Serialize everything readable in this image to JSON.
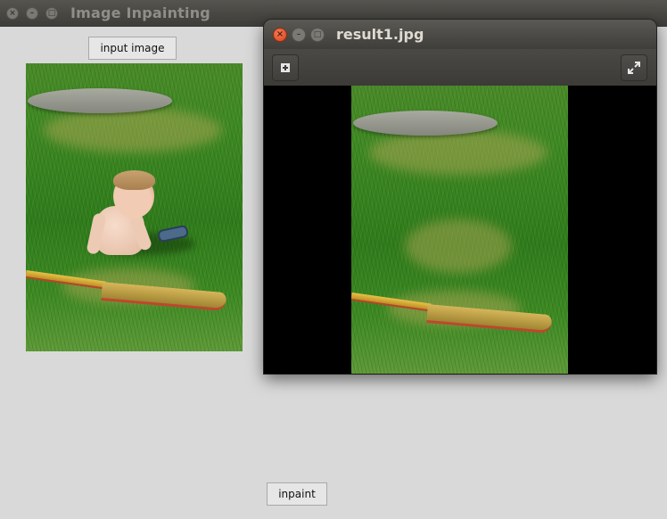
{
  "main_window": {
    "title": "Image Inpainting",
    "input_button_label": "input image",
    "inpaint_button_label": "inpaint",
    "titlebar_buttons": [
      "close-icon",
      "minimize-icon",
      "maximize-icon"
    ]
  },
  "result_window": {
    "title": "result1.jpg",
    "toolbar": {
      "left_icon": "add-icon",
      "right_icon": "fullscreen-icon"
    }
  },
  "colors": {
    "desktop_bg": "#d9d9d9",
    "titlebar_dark": "#3d3c38",
    "close_orange": "#e0511f",
    "grass_green": "#3f8a26",
    "canvas_black": "#000000"
  }
}
